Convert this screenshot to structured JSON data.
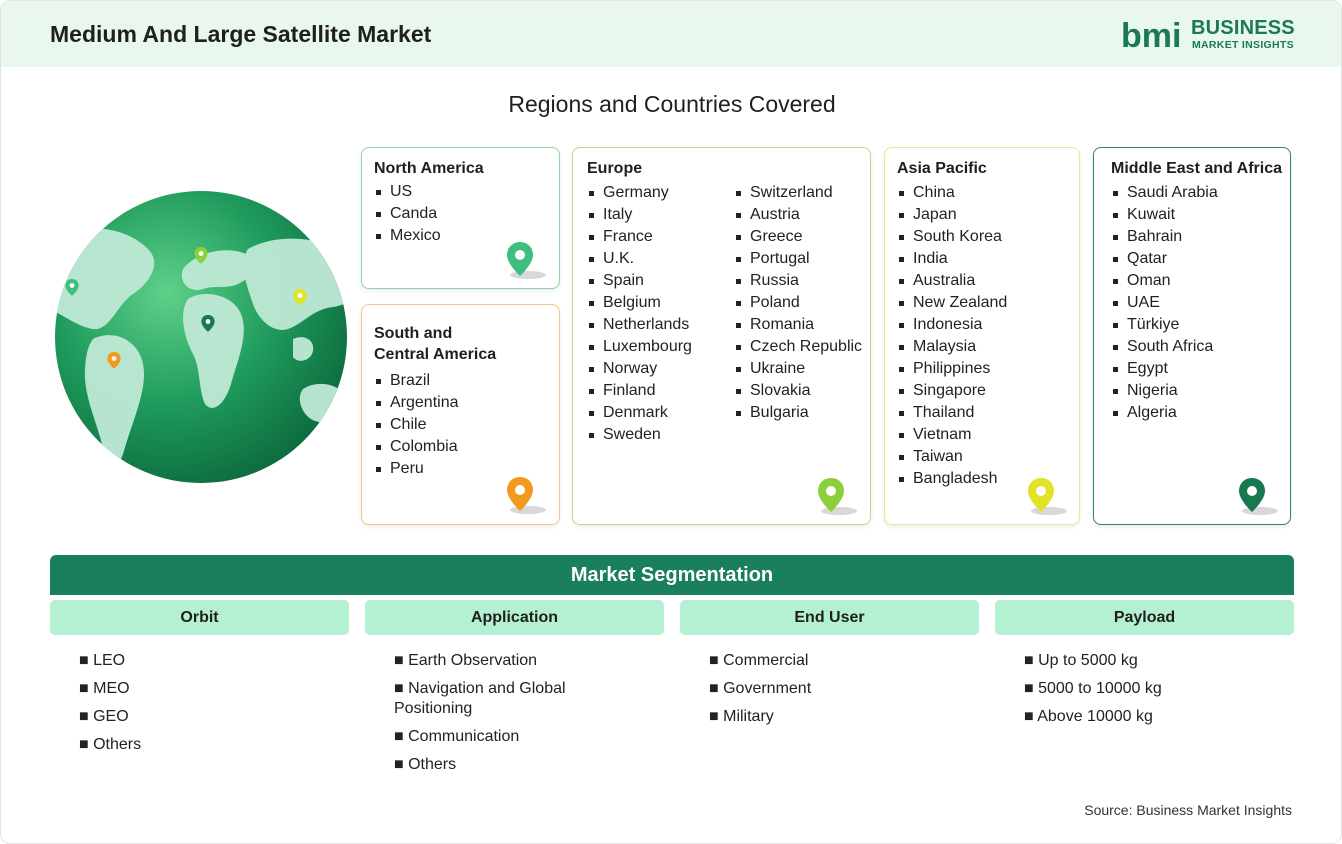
{
  "header": {
    "title": "Medium And Large Satellite Market",
    "logo_line1": "BUSINESS",
    "logo_line2": "MARKET INSIGHTS",
    "logo_glyphs": "bmi"
  },
  "regions_title": "Regions and Countries Covered",
  "regions": {
    "north_america": {
      "name": "North America",
      "countries": [
        "US",
        "Canda",
        "Mexico"
      ]
    },
    "south_central_america": {
      "name_line1": "South and",
      "name_line2": "Central America",
      "countries": [
        "Brazil",
        "Argentina",
        "Chile",
        "Colombia",
        "Peru"
      ]
    },
    "europe": {
      "name": "Europe",
      "countries_col1": [
        "Germany",
        "Italy",
        "France",
        "U.K.",
        "Spain",
        "Belgium",
        "Netherlands",
        "Luxembourg",
        "Norway",
        "Finland",
        "Denmark",
        "Sweden"
      ],
      "countries_col2": [
        "Switzerland",
        "Austria",
        "Greece",
        "Portugal",
        "Russia",
        "Poland",
        "Romania",
        "Czech Republic",
        "Ukraine",
        "Slovakia",
        "Bulgaria"
      ]
    },
    "asia_pacific": {
      "name": "Asia Pacific",
      "countries": [
        "China",
        "Japan",
        "South Korea",
        "India",
        "Australia",
        "New Zealand",
        "Indonesia",
        "Malaysia",
        "Philippines",
        "Singapore",
        "Thailand",
        "Vietnam",
        "Taiwan",
        "Bangladesh"
      ]
    },
    "middle_east_africa": {
      "name": "Middle East and Africa",
      "countries": [
        "Saudi Arabia",
        "Kuwait",
        "Bahrain",
        "Qatar",
        "Oman",
        "UAE",
        "Türkiye",
        "South Africa",
        "Egypt",
        "Nigeria",
        "Algeria"
      ]
    }
  },
  "colors": {
    "brand": "#1b7a55",
    "segment_header": "#1a7f5c",
    "segment_col": "#b4f1d2",
    "pin_north_america": "#3fbf7f",
    "pin_south_america": "#f29a1e",
    "pin_europe": "#8ccf3c",
    "pin_asia_pacific": "#e3e22a",
    "pin_middle_east_africa": "#17794d"
  },
  "segmentation": {
    "title": "Market Segmentation",
    "columns": [
      {
        "title": "Orbit",
        "items": [
          "■ LEO",
          "■ MEO",
          "■ GEO",
          "■ Others"
        ]
      },
      {
        "title": "Application",
        "items": [
          "■ Earth Observation",
          "■ Navigation and Global Positioning",
          "■ Communication",
          "■ Others"
        ]
      },
      {
        "title": "End User",
        "items": [
          "■ Commercial",
          "■ Government",
          "■ Military"
        ]
      },
      {
        "title": "Payload",
        "items": [
          "■ Up to 5000 kg",
          "■ 5000 to 10000 kg",
          "■ Above 10000 kg"
        ]
      }
    ]
  },
  "source": "Source: Business Market Insights"
}
